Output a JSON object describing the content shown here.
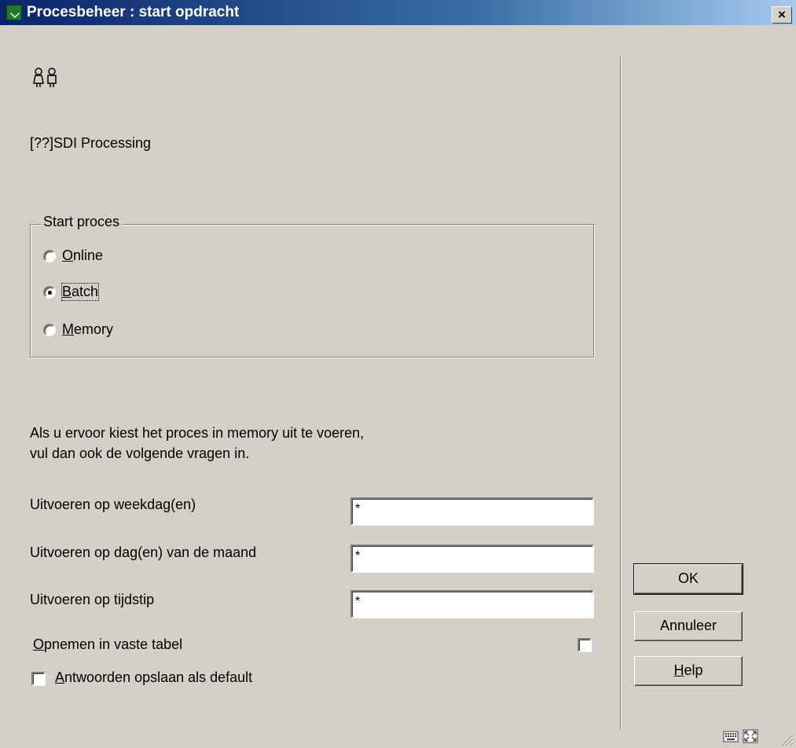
{
  "window": {
    "title": "Procesbeheer : start opdracht",
    "close_label": "×"
  },
  "process_name": "[??]SDI Processing",
  "start_group": {
    "legend": "Start proces",
    "options": [
      {
        "accesskey": "O",
        "rest": "nline",
        "selected": false
      },
      {
        "accesskey": "B",
        "rest": "atch",
        "selected": true
      },
      {
        "accesskey": "M",
        "rest": "emory",
        "selected": false
      }
    ]
  },
  "memory_note": {
    "line1": "Als u ervoor kiest het proces in memory uit te voeren,",
    "line2": "vul dan ook de volgende vragen in."
  },
  "fields": [
    {
      "label": "Uitvoeren op weekdag(en)",
      "value": "*"
    },
    {
      "label": "Uitvoeren op dag(en) van de maand",
      "value": "*"
    },
    {
      "label": "Uitvoeren op tijdstip",
      "value": "*"
    }
  ],
  "fixed_table": {
    "accesskey": "O",
    "rest": "pnemen in vaste tabel",
    "checked": false
  },
  "save_default": {
    "accesskey": "A",
    "rest": "ntwoorden opslaan als default",
    "checked": false
  },
  "buttons": {
    "ok": "OK",
    "cancel": "Annuleer",
    "help_accesskey": "H",
    "help_rest": "elp"
  },
  "icons": {
    "title": "app-icon",
    "people": "people-icon",
    "keyboard": "keyboard-icon",
    "expand": "expand-icon",
    "grip": "resize-grip-icon"
  }
}
